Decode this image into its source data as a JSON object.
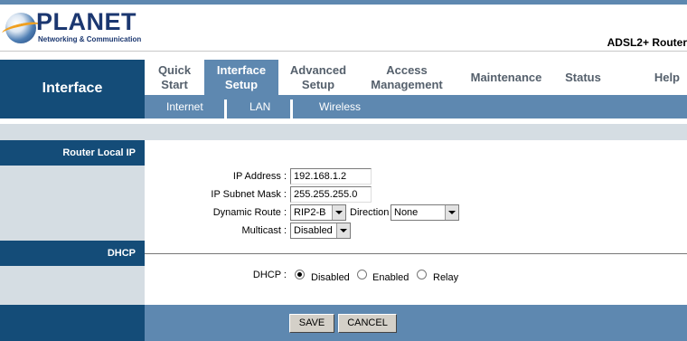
{
  "header": {
    "brand": "PLANET",
    "tagline": "Networking & Communication",
    "product": "ADSL2+ Router"
  },
  "nav": {
    "section_title": "Interface",
    "tabs": [
      {
        "label": "Quick\nStart",
        "active": false
      },
      {
        "label": "Interface\nSetup",
        "active": true
      },
      {
        "label": "Advanced\nSetup",
        "active": false
      },
      {
        "label": "Access\nManagement",
        "active": false
      },
      {
        "label": "Maintenance",
        "active": false
      },
      {
        "label": "Status",
        "active": false
      },
      {
        "label": "Help",
        "active": false
      }
    ],
    "subtabs": [
      "Internet",
      "LAN",
      "Wireless"
    ]
  },
  "sections": {
    "router_local_ip": "Router Local IP",
    "dhcp": "DHCP"
  },
  "form": {
    "ip_address": {
      "label": "IP Address :",
      "value": "192.168.1.2"
    },
    "subnet_mask": {
      "label": "IP Subnet Mask :",
      "value": "255.255.255.0"
    },
    "dynamic_route": {
      "label": "Dynamic Route :",
      "value": "RIP2-B"
    },
    "direction": {
      "label": "Direction",
      "value": "None"
    },
    "multicast": {
      "label": "Multicast :",
      "value": "Disabled"
    },
    "dhcp": {
      "label": "DHCP :",
      "options": [
        "Disabled",
        "Enabled",
        "Relay"
      ],
      "selected": "Disabled"
    }
  },
  "buttons": {
    "save": "SAVE",
    "cancel": "CANCEL"
  },
  "colors": {
    "dark_blue": "#144c78",
    "mid_blue": "#5e88b0",
    "light_gray_blue": "#d5dde3"
  }
}
